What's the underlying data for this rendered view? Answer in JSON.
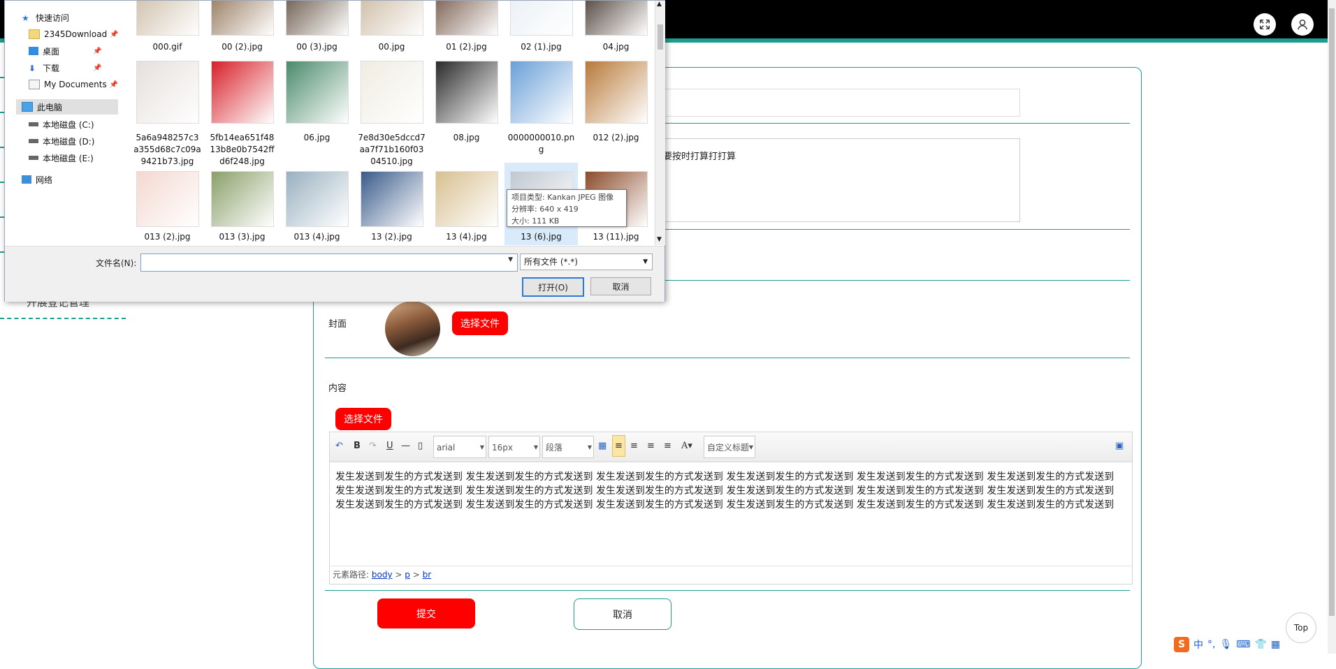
{
  "header": {
    "fullscreen_icon": "fullscreen-icon",
    "user_icon": "user-icon"
  },
  "sidebar": {
    "partial_item": "开展登记管理"
  },
  "form": {
    "textarea_value": "要按时打算打打算",
    "cover_label": "封面",
    "choose_file_label": "选择文件",
    "content_label": "内容",
    "submit_label": "提交",
    "cancel_label": "取消"
  },
  "editor": {
    "font_family": "arial",
    "font_size": "16px",
    "paragraph": "段落",
    "custom_title": "自定义标题",
    "body_text": " 发生发送到发生的方式发送到 发生发送到发生的方式发送到 发生发送到发生的方式发送到 发生发送到发生的方式发送到 发生发送到发生的方式发送到 发生发送到发生的方式发送到 发生发送到发生的方式发送到 发生发送到发生的方式发送到 发生发送到发生的方式发送到 发生发送到发生的方式发送到 发生发送到发生的方式发送到 发生发送到发生的方式发送到 发生发送到发生的方式发送到 发生发送到发生的方式发送到 发生发送到发生的方式发送到 发生发送到发生的方式发送到 发生发送到发生的方式发送到 发生发送到发生的方式发送到",
    "path_label": "元素路径:",
    "path_body": "body",
    "path_p": "p",
    "path_br": "br",
    "path_sep": ">"
  },
  "top_button": "Top",
  "ime": {
    "lang": "中"
  },
  "dialog": {
    "nav": [
      {
        "label": "快速访问",
        "icon": "star-icon"
      },
      {
        "label": "2345Download",
        "icon": "folder-icon",
        "pinned": true
      },
      {
        "label": "桌面",
        "icon": "desktop-icon",
        "pinned": true
      },
      {
        "label": "下载",
        "icon": "download-icon",
        "pinned": true
      },
      {
        "label": "My Documents",
        "icon": "documents-icon",
        "pinned": true
      },
      {
        "label": "此电脑",
        "icon": "computer-icon"
      },
      {
        "label": "本地磁盘 (C:)",
        "icon": "drive-icon"
      },
      {
        "label": "本地磁盘 (D:)",
        "icon": "drive-icon"
      },
      {
        "label": "本地磁盘 (E:)",
        "icon": "drive-icon"
      },
      {
        "label": "网络",
        "icon": "network-icon"
      }
    ],
    "files_row1": [
      "000.gif",
      "00 (2).jpg",
      "00 (3).jpg",
      "00.jpg",
      "01 (2).jpg",
      "02 (1).jpg",
      "04.jpg"
    ],
    "files_row2": [
      "5a6a948257c3a355d68c7c09a9421b73.jpg",
      "5fb14ea651f4813b8e0b7542ffd6f248.jpg",
      "06.jpg",
      "7e8d30e5dccd7aa7f71b160f0304510.jpg",
      "08.jpg",
      "0000000010.png",
      "012 (2).jpg"
    ],
    "files_row3": [
      "013 (2).jpg",
      "013 (3).jpg",
      "013 (4).jpg",
      "13 (2).jpg",
      "13 (4).jpg",
      "13 (6).jpg",
      "13 (11).jpg"
    ],
    "tooltip": {
      "type": "项目类型: Kankan JPEG 图像",
      "resolution": "分辨率: 640 x 419",
      "size": "大小: 111 KB"
    },
    "filename_label": "文件名(N):",
    "filename_value": "",
    "filetype": "所有文件 (*.*)",
    "open_label": "打开(O)",
    "cancel_label": "取消"
  }
}
